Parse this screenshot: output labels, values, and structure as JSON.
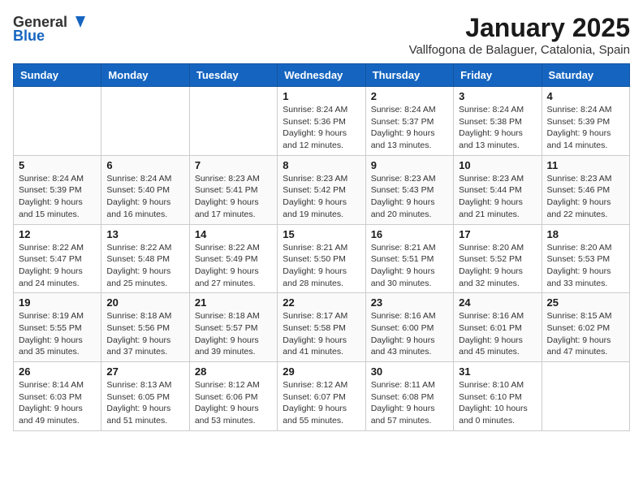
{
  "logo": {
    "general": "General",
    "blue": "Blue"
  },
  "title": "January 2025",
  "subtitle": "Vallfogona de Balaguer, Catalonia, Spain",
  "days_of_week": [
    "Sunday",
    "Monday",
    "Tuesday",
    "Wednesday",
    "Thursday",
    "Friday",
    "Saturday"
  ],
  "weeks": [
    [
      {
        "day": "",
        "info": ""
      },
      {
        "day": "",
        "info": ""
      },
      {
        "day": "",
        "info": ""
      },
      {
        "day": "1",
        "info": "Sunrise: 8:24 AM\nSunset: 5:36 PM\nDaylight: 9 hours\nand 12 minutes."
      },
      {
        "day": "2",
        "info": "Sunrise: 8:24 AM\nSunset: 5:37 PM\nDaylight: 9 hours\nand 13 minutes."
      },
      {
        "day": "3",
        "info": "Sunrise: 8:24 AM\nSunset: 5:38 PM\nDaylight: 9 hours\nand 13 minutes."
      },
      {
        "day": "4",
        "info": "Sunrise: 8:24 AM\nSunset: 5:39 PM\nDaylight: 9 hours\nand 14 minutes."
      }
    ],
    [
      {
        "day": "5",
        "info": "Sunrise: 8:24 AM\nSunset: 5:39 PM\nDaylight: 9 hours\nand 15 minutes."
      },
      {
        "day": "6",
        "info": "Sunrise: 8:24 AM\nSunset: 5:40 PM\nDaylight: 9 hours\nand 16 minutes."
      },
      {
        "day": "7",
        "info": "Sunrise: 8:23 AM\nSunset: 5:41 PM\nDaylight: 9 hours\nand 17 minutes."
      },
      {
        "day": "8",
        "info": "Sunrise: 8:23 AM\nSunset: 5:42 PM\nDaylight: 9 hours\nand 19 minutes."
      },
      {
        "day": "9",
        "info": "Sunrise: 8:23 AM\nSunset: 5:43 PM\nDaylight: 9 hours\nand 20 minutes."
      },
      {
        "day": "10",
        "info": "Sunrise: 8:23 AM\nSunset: 5:44 PM\nDaylight: 9 hours\nand 21 minutes."
      },
      {
        "day": "11",
        "info": "Sunrise: 8:23 AM\nSunset: 5:46 PM\nDaylight: 9 hours\nand 22 minutes."
      }
    ],
    [
      {
        "day": "12",
        "info": "Sunrise: 8:22 AM\nSunset: 5:47 PM\nDaylight: 9 hours\nand 24 minutes."
      },
      {
        "day": "13",
        "info": "Sunrise: 8:22 AM\nSunset: 5:48 PM\nDaylight: 9 hours\nand 25 minutes."
      },
      {
        "day": "14",
        "info": "Sunrise: 8:22 AM\nSunset: 5:49 PM\nDaylight: 9 hours\nand 27 minutes."
      },
      {
        "day": "15",
        "info": "Sunrise: 8:21 AM\nSunset: 5:50 PM\nDaylight: 9 hours\nand 28 minutes."
      },
      {
        "day": "16",
        "info": "Sunrise: 8:21 AM\nSunset: 5:51 PM\nDaylight: 9 hours\nand 30 minutes."
      },
      {
        "day": "17",
        "info": "Sunrise: 8:20 AM\nSunset: 5:52 PM\nDaylight: 9 hours\nand 32 minutes."
      },
      {
        "day": "18",
        "info": "Sunrise: 8:20 AM\nSunset: 5:53 PM\nDaylight: 9 hours\nand 33 minutes."
      }
    ],
    [
      {
        "day": "19",
        "info": "Sunrise: 8:19 AM\nSunset: 5:55 PM\nDaylight: 9 hours\nand 35 minutes."
      },
      {
        "day": "20",
        "info": "Sunrise: 8:18 AM\nSunset: 5:56 PM\nDaylight: 9 hours\nand 37 minutes."
      },
      {
        "day": "21",
        "info": "Sunrise: 8:18 AM\nSunset: 5:57 PM\nDaylight: 9 hours\nand 39 minutes."
      },
      {
        "day": "22",
        "info": "Sunrise: 8:17 AM\nSunset: 5:58 PM\nDaylight: 9 hours\nand 41 minutes."
      },
      {
        "day": "23",
        "info": "Sunrise: 8:16 AM\nSunset: 6:00 PM\nDaylight: 9 hours\nand 43 minutes."
      },
      {
        "day": "24",
        "info": "Sunrise: 8:16 AM\nSunset: 6:01 PM\nDaylight: 9 hours\nand 45 minutes."
      },
      {
        "day": "25",
        "info": "Sunrise: 8:15 AM\nSunset: 6:02 PM\nDaylight: 9 hours\nand 47 minutes."
      }
    ],
    [
      {
        "day": "26",
        "info": "Sunrise: 8:14 AM\nSunset: 6:03 PM\nDaylight: 9 hours\nand 49 minutes."
      },
      {
        "day": "27",
        "info": "Sunrise: 8:13 AM\nSunset: 6:05 PM\nDaylight: 9 hours\nand 51 minutes."
      },
      {
        "day": "28",
        "info": "Sunrise: 8:12 AM\nSunset: 6:06 PM\nDaylight: 9 hours\nand 53 minutes."
      },
      {
        "day": "29",
        "info": "Sunrise: 8:12 AM\nSunset: 6:07 PM\nDaylight: 9 hours\nand 55 minutes."
      },
      {
        "day": "30",
        "info": "Sunrise: 8:11 AM\nSunset: 6:08 PM\nDaylight: 9 hours\nand 57 minutes."
      },
      {
        "day": "31",
        "info": "Sunrise: 8:10 AM\nSunset: 6:10 PM\nDaylight: 10 hours\nand 0 minutes."
      },
      {
        "day": "",
        "info": ""
      }
    ]
  ]
}
